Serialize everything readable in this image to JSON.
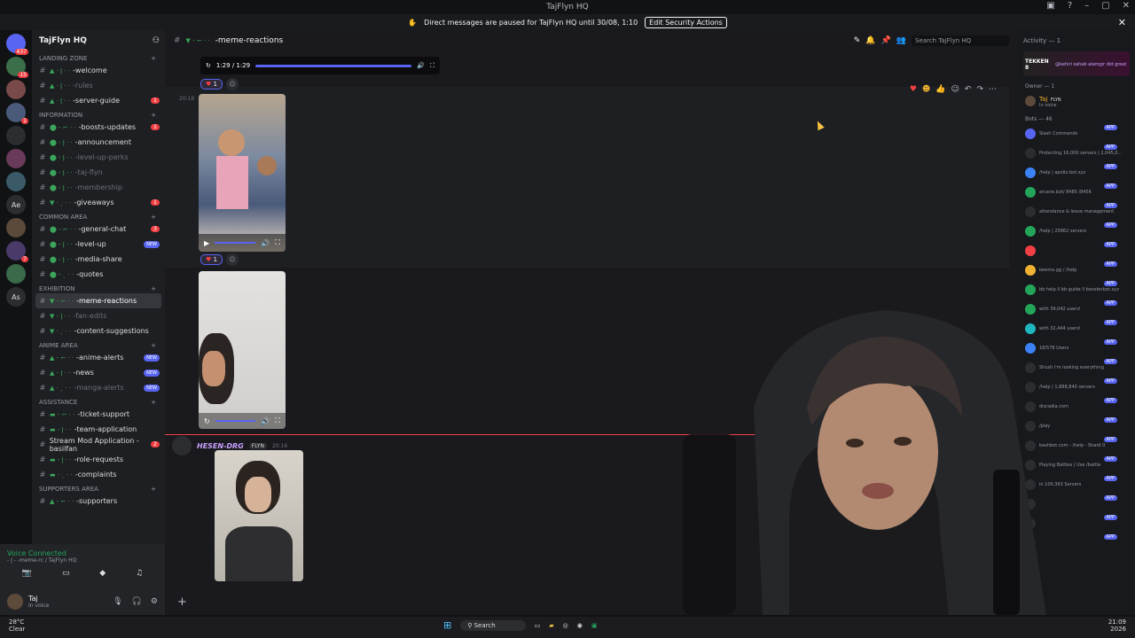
{
  "window": {
    "title": "TajFlyn HQ"
  },
  "banner": {
    "text": "Direct messages are paused for TajFlyn HQ until 30/08, 1:10",
    "button": "Edit Security Actions"
  },
  "servers": [
    {
      "label": "",
      "badge": "437"
    },
    {
      "label": "",
      "badge": "15"
    },
    {
      "label": "",
      "badge": ""
    },
    {
      "label": "",
      "badge": "1"
    },
    {
      "label": "",
      "badge": ""
    },
    {
      "label": "",
      "badge": ""
    },
    {
      "label": "",
      "badge": ""
    },
    {
      "label": "Ae",
      "badge": ""
    },
    {
      "label": "",
      "badge": ""
    },
    {
      "label": "",
      "badge": "7"
    },
    {
      "label": "",
      "badge": ""
    },
    {
      "label": "As",
      "badge": ""
    }
  ],
  "server_name": "TajFlyn HQ",
  "channels": [
    {
      "type": "cat",
      "label": "LANDING ZONE"
    },
    {
      "type": "ch",
      "name": "-welcome",
      "pfx": "▲ · ǀ · ·",
      "state": ""
    },
    {
      "type": "ch",
      "name": "-rules",
      "pfx": "▲ · ǀ · ·",
      "state": "muted"
    },
    {
      "type": "ch",
      "name": "-server-guide",
      "pfx": "▲ · ǀ · ·",
      "state": "",
      "badge": "1"
    },
    {
      "type": "cat",
      "label": "INFORMATION"
    },
    {
      "type": "ch",
      "name": "-boosts-updates",
      "pfx": "⬤ - ⌐ · ·",
      "state": "",
      "badge": "1"
    },
    {
      "type": "ch",
      "name": "-announcement",
      "pfx": "⬤ - ǀ · ·",
      "state": ""
    },
    {
      "type": "ch",
      "name": "-level-up-perks",
      "pfx": "⬤ - ǀ · ·",
      "state": "muted"
    },
    {
      "type": "ch",
      "name": "-taj-flyn",
      "pfx": "⬤ - ǀ · ·",
      "state": "muted"
    },
    {
      "type": "ch",
      "name": "-membership",
      "pfx": "⬤ - ǀ · ·",
      "state": "muted"
    },
    {
      "type": "ch",
      "name": "-giveaways",
      "pfx": "▼ · ˎ · ·",
      "state": "",
      "badge": "1"
    },
    {
      "type": "cat",
      "label": "COMMON AREA"
    },
    {
      "type": "ch",
      "name": "-general-chat",
      "pfx": "⬤ - ⌐ · ·",
      "state": "",
      "badge": "3"
    },
    {
      "type": "ch",
      "name": "-level-up",
      "pfx": "⬤ - ǀ · ·",
      "state": "",
      "new": "NEW"
    },
    {
      "type": "ch",
      "name": "-media-share",
      "pfx": "⬤ - ǀ · ·",
      "state": ""
    },
    {
      "type": "ch",
      "name": "-quotes",
      "pfx": "⬤ - ˎ · ·",
      "state": ""
    },
    {
      "type": "cat",
      "label": "EXHIBITION"
    },
    {
      "type": "ch",
      "name": "-meme-reactions",
      "pfx": "▼ - ⌐ · ·",
      "state": "active"
    },
    {
      "type": "ch",
      "name": "-fan-edits",
      "pfx": "▼ - ǀ · ·",
      "state": "muted"
    },
    {
      "type": "ch",
      "name": "-content-suggestions",
      "pfx": "▼ · ˎ · ·",
      "state": ""
    },
    {
      "type": "cat",
      "label": "ANIME AREA"
    },
    {
      "type": "ch",
      "name": "-anime-alerts",
      "pfx": "▲ - ⌐ · ·",
      "state": "",
      "new": "NEW"
    },
    {
      "type": "ch",
      "name": "-news",
      "pfx": "▲ - ǀ · ·",
      "state": "",
      "new": "NEW"
    },
    {
      "type": "ch",
      "name": "-manga-alerts",
      "pfx": "▲ · ˎ · ·",
      "state": "muted",
      "new": "NEW"
    },
    {
      "type": "cat",
      "label": "ASSISTANCE"
    },
    {
      "type": "ch",
      "name": "-ticket-support",
      "pfx": "▬ - ⌐ · ·",
      "state": ""
    },
    {
      "type": "ch",
      "name": "-team-application",
      "pfx": "▬ - ǀ · ·",
      "state": ""
    },
    {
      "type": "ch",
      "name": "Stream Mod Application - basilfan",
      "pfx": "",
      "state": "",
      "badge": "2"
    },
    {
      "type": "ch",
      "name": "-role-requests",
      "pfx": "▬ - ǀ · ·",
      "state": ""
    },
    {
      "type": "ch",
      "name": "-complaints",
      "pfx": "▬ · ˎ · ·",
      "state": ""
    },
    {
      "type": "cat",
      "label": "SUPPORTERS AREA"
    },
    {
      "type": "ch",
      "name": "-supporters",
      "pfx": "▲ - ⌐ · ·",
      "state": ""
    }
  ],
  "voice": {
    "status": "Voice Connected",
    "location": "- ǀ - -meme-rc / TajFlyn HQ"
  },
  "user": {
    "name": "Taj",
    "status": "In voice"
  },
  "channel_header": {
    "name": "-meme-reactions",
    "prefix": "▼ - ⌐ · ·",
    "search_placeholder": "Search TajFlyn HQ"
  },
  "player": {
    "time": "1:29 / 1:29"
  },
  "reactions": [
    {
      "count": "1"
    },
    {
      "count": "1"
    }
  ],
  "timestamps": [
    "20:16",
    "20:16"
  ],
  "author": {
    "name": "HESEN-DRG",
    "tag": "FLYN",
    "time": "20:16"
  },
  "members": {
    "activity": "Activity — 1",
    "activity_game": "TEKKEN 8",
    "activity_text": "@kehiri sahab alamgir did great job",
    "owner_cat": "Owner — 1",
    "owner_name": "Taj",
    "owner_tag": "FLYN",
    "owner_sub": "In voice",
    "bots_cat": "Bots — 46",
    "bots": [
      {
        "text": "Slash Commands",
        "app": "APP"
      },
      {
        "text": "Protecting 16,000 servers | 2,045,0...",
        "app": "APP"
      },
      {
        "text": "/help | apollo.bot.xyz",
        "app": "APP"
      },
      {
        "text": "arcane.bot/ 8480 /8456",
        "app": "APP"
      },
      {
        "text": "attendance & leave management",
        "app": "APP"
      },
      {
        "text": "/help | 25862 servers",
        "app": "APP"
      },
      {
        "text": "",
        "app": "APP"
      },
      {
        "text": "beemo.gg / /help",
        "app": "APP"
      },
      {
        "text": "bb help ll bb guide ll boosterbot.xyz",
        "app": "APP"
      },
      {
        "text": "with 39,042 users!",
        "app": "APP"
      },
      {
        "text": "with 32,444 users!",
        "app": "APP"
      },
      {
        "text": "18/578 Users",
        "app": "APP"
      },
      {
        "text": "Shush I'm looking everything",
        "app": "APP"
      },
      {
        "text": "/help | 1,888,840 servers",
        "app": "APP"
      },
      {
        "text": "discadia.com",
        "app": "APP"
      },
      {
        "text": "/play",
        "app": "APP"
      },
      {
        "text": "bashbot.com - /help - Shard 0",
        "app": "APP"
      },
      {
        "text": "Playing Battles | Use /battle",
        "app": "APP"
      },
      {
        "text": "in 100,363 Servers",
        "app": "APP"
      },
      {
        "text": "",
        "app": "APP"
      },
      {
        "text": "",
        "app": "APP"
      },
      {
        "text": "",
        "app": "APP"
      }
    ]
  },
  "taskbar": {
    "temp": "28°C",
    "weather": "Clear",
    "search": "Search",
    "time": "21:09",
    "date": "2026"
  }
}
